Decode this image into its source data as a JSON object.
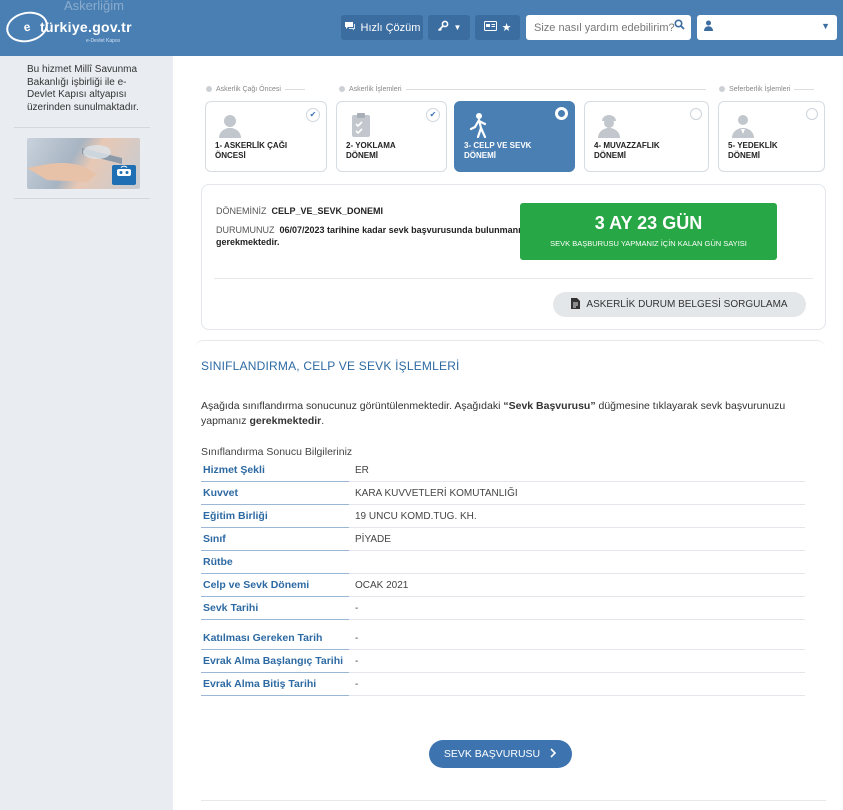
{
  "header": {
    "ghost_title": "Askerliğim",
    "logo_text": "türkiye.gov.tr",
    "logo_sub": "e-Devlet Kapısı",
    "quick_solution_label": "Hızlı Çözüm",
    "search_placeholder": "Size nasıl yardım edebilirim?",
    "accent": "#4a7fb3"
  },
  "sidebar": {
    "info_text": "Bu hizmet Millî Savunma Bakanlığı işbirliği ile e-Devlet Kapısı altyapısı üzerinden sunulmaktadır."
  },
  "tracks": {
    "pre": "Askerlik Çağı Öncesi",
    "ops": "Askerlik İşlemleri",
    "mob": "Seferberlik İşlemleri"
  },
  "steps": [
    {
      "label_1": "1- ASKERLİK ÇAĞI",
      "label_2": "ÖNCESİ",
      "state": "done"
    },
    {
      "label_1": "2- YOKLAMA",
      "label_2": "DÖNEMİ",
      "state": "done"
    },
    {
      "label_1": "3- CELP VE SEVK",
      "label_2": "DÖNEMİ",
      "state": "active"
    },
    {
      "label_1": "4- MUVAZZAFLIK",
      "label_2": "DÖNEMİ",
      "state": "pending"
    },
    {
      "label_1": "5- YEDEKLİK",
      "label_2": "DÖNEMİ",
      "state": "pending"
    }
  ],
  "status": {
    "period_label": "DÖNEMİNİZ",
    "period_value": "CELP_VE_SEVK_DONEMI",
    "state_label": "DURUMUNUZ",
    "state_value": "06/07/2023 tarihine kadar sevk başvurusunda bulunmanız gerekmektedir.",
    "countdown_value": "3 AY 23 GÜN",
    "countdown_caption": "SEVK BAŞBURUSU YAPMANIZ İÇİN KALAN GÜN SAYISI",
    "countdown_color": "#27a745",
    "doc_button": "ASKERLİK DURUM BELGESİ SORGULAMA"
  },
  "section": {
    "title": "SINIFLANDIRMA, CELP VE SEVK İŞLEMLERİ",
    "desc_1": "Aşağıda sınıflandırma sonucunuz görüntülenmektedir. Aşağıdaki",
    "desc_bold": "“Sevk Başvurusu”",
    "desc_2": "düğmesine tıklayarak sevk başvurunuzu yapmanız",
    "desc_bold_2": "gerekmektedir",
    "desc_end": ".",
    "sub_title": "Sınıflandırma Sonucu Bilgileriniz",
    "rows": [
      {
        "key": "Hizmet Şekli",
        "value": "ER"
      },
      {
        "key": "Kuvvet",
        "value": "KARA KUVVETLERİ KOMUTANLIĞI"
      },
      {
        "key": "Eğitim Birliği",
        "value": "19 UNCU KOMD.TUG. KH."
      },
      {
        "key": "Sınıf",
        "value": "PİYADE"
      },
      {
        "key": "Rütbe",
        "value": ""
      },
      {
        "key": "Celp ve Sevk Dönemi",
        "value": "OCAK 2021"
      },
      {
        "key": "Sevk Tarihi",
        "value": "-"
      },
      {
        "key": "Katılması Gereken Tarih",
        "value": "-"
      },
      {
        "key": "Evrak Alma Başlangıç Tarihi",
        "value": "-"
      },
      {
        "key": "Evrak Alma Bitiş Tarihi",
        "value": "-"
      }
    ],
    "sevk_button": "SEVK BAŞVURUSU"
  }
}
